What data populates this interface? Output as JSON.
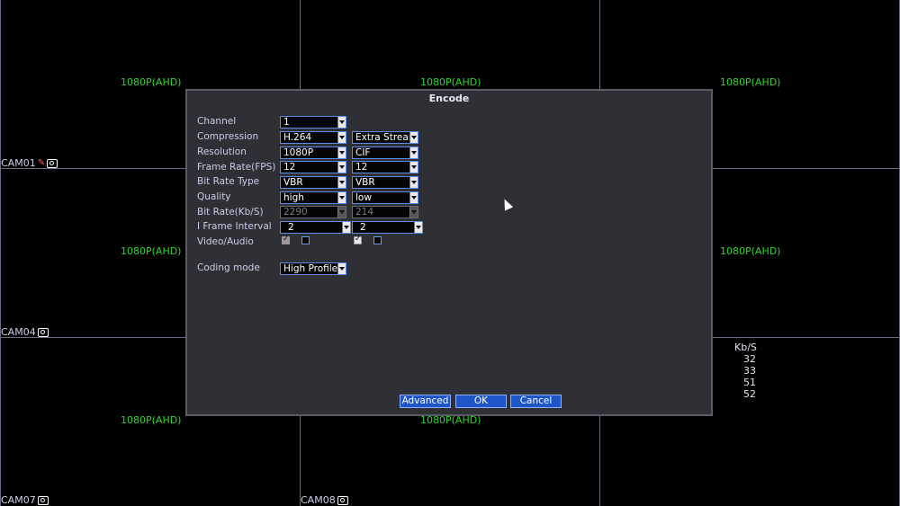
{
  "grid": {
    "resolution_labels": [
      "1080P(AHD)",
      "1080P(AHD)",
      "1080P(AHD)",
      "1080P(AHD)",
      "1080P(AHD)",
      "1080P(AHD)",
      "1080P(AHD)"
    ],
    "cameras": [
      "CAM01",
      "CAM04",
      "CAM07",
      "CAM08"
    ]
  },
  "bitrate_panel": {
    "unit": "Kb/S",
    "values": [
      "32",
      "33",
      "51",
      "52"
    ]
  },
  "dialog": {
    "title": "Encode",
    "labels": {
      "channel": "Channel",
      "compression": "Compression",
      "resolution": "Resolution",
      "frame_rate": "Frame Rate(FPS)",
      "bit_rate_type": "Bit Rate Type",
      "quality": "Quality",
      "bit_rate": "Bit Rate(Kb/S)",
      "i_frame_interval": "I Frame Interval",
      "video_audio": "Video/Audio",
      "coding_mode": "Coding mode"
    },
    "main_stream": {
      "channel": "1",
      "compression": "H.264",
      "resolution": "1080P",
      "frame_rate": "12",
      "bit_rate_type": "VBR",
      "quality": "high",
      "bit_rate": "2290",
      "i_frame_interval": "2",
      "video_checked": true,
      "audio_checked": false
    },
    "extra_stream": {
      "stream": "Extra Stream",
      "resolution": "CIF",
      "frame_rate": "12",
      "bit_rate_type": "VBR",
      "quality": "low",
      "bit_rate": "214",
      "i_frame_interval": "2",
      "video_checked": true,
      "audio_checked": false
    },
    "coding_mode": "High Profile",
    "buttons": {
      "advanced": "Advanced",
      "ok": "OK",
      "cancel": "Cancel"
    }
  },
  "colors": {
    "resolution_text": "#2fd62f",
    "accent": "#1e55c8",
    "dialog_bg": "#2f3035"
  }
}
